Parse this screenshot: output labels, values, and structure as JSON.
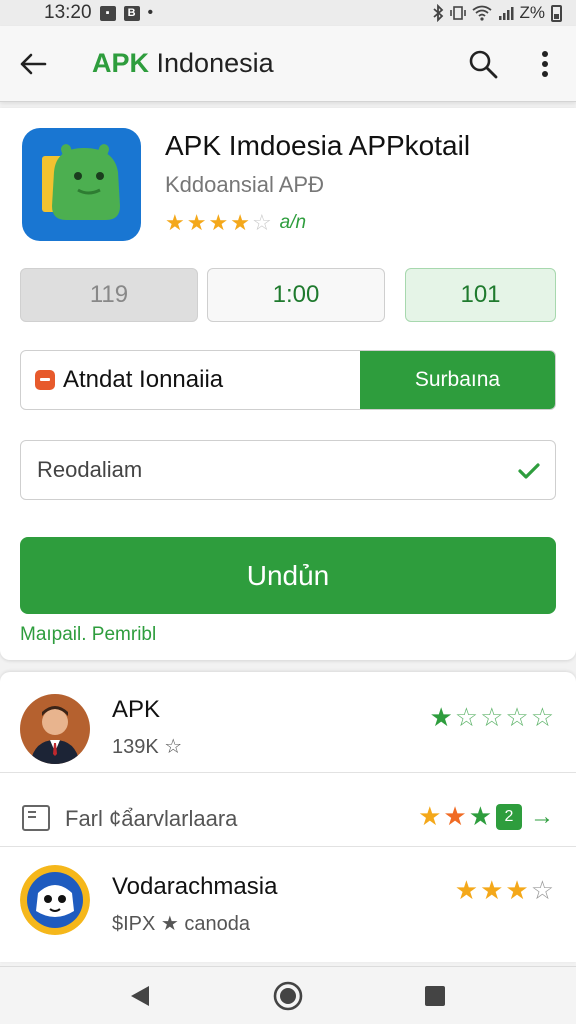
{
  "status_bar": {
    "time": "13:20",
    "right_text": "Z%"
  },
  "app_bar": {
    "title_accent": "APK",
    "title_rest": " Indonesia",
    "icons": [
      "back-arrow-icon",
      "search-icon",
      "more-vert-icon"
    ]
  },
  "app": {
    "name": "APK Imdoesia APPkotail",
    "developer": "Kddoansial APÐ",
    "rating_stars": 4,
    "rating_max": 5,
    "rating_text": "a/n",
    "colors": {
      "accent": "#2e9d3d",
      "star": "#f4a81a",
      "icon_bg": "#1976d2"
    }
  },
  "stats": [
    "119",
    "1:00",
    "101"
  ],
  "split": {
    "left_label": "Atndat Ionnaiia",
    "right_label": "Surbaına"
  },
  "select": {
    "value": "Reodaliam"
  },
  "primary_button": {
    "label": "Undủn"
  },
  "helper_link": "Maıpail. Pemribl",
  "list": [
    {
      "title": "APK",
      "subtitle": "139K ☆",
      "stars_filled": 1,
      "stars_total": 5
    },
    {
      "title": "Farl ¢ẩarvlarlaara",
      "stars_filled": 3,
      "badge": "2"
    },
    {
      "title": "Vodarachmasia",
      "subtitle": "$IPX ★ canoda",
      "stars_filled": 3,
      "stars_total": 4
    }
  ],
  "nav_bar": {
    "icons": [
      "back-triangle-icon",
      "home-circle-icon",
      "recents-square-icon"
    ]
  }
}
